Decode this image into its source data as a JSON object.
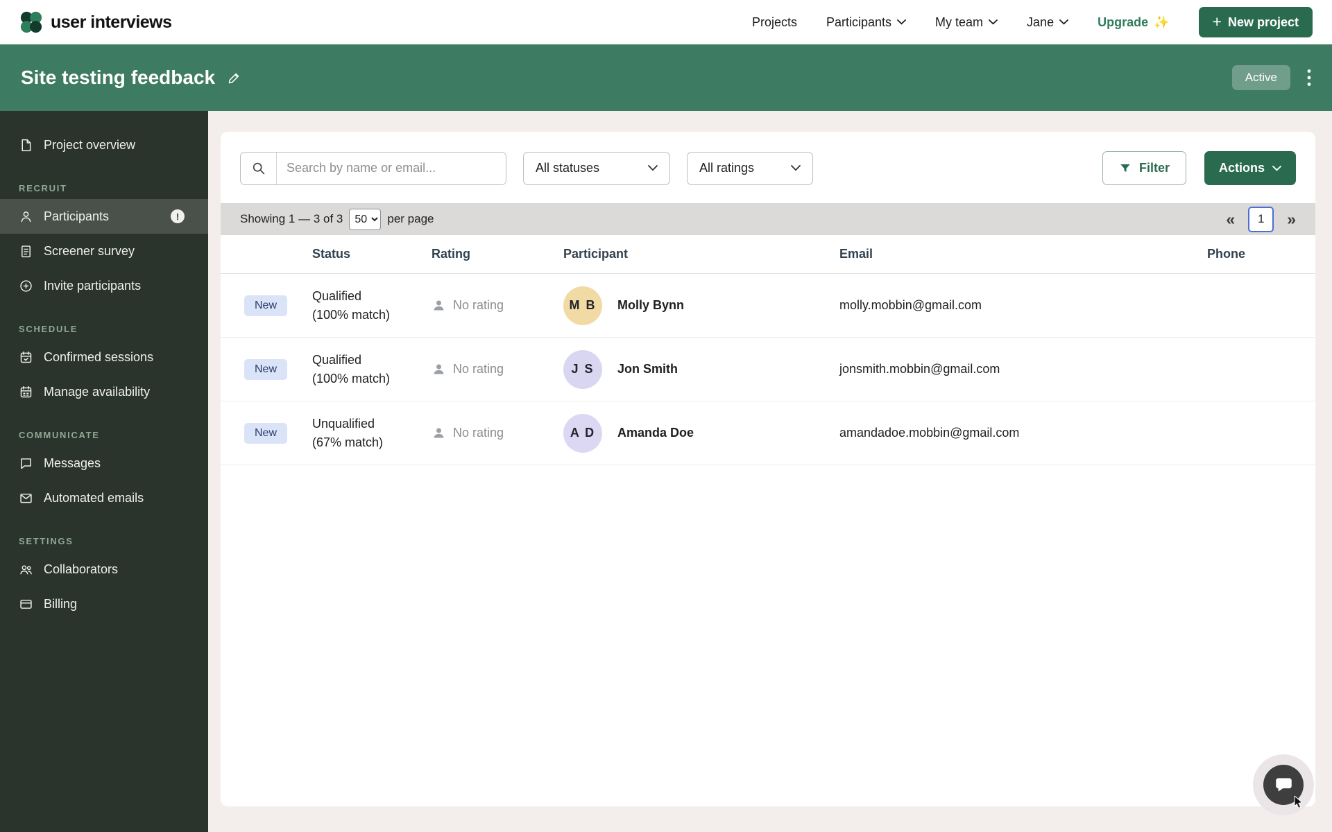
{
  "colors": {
    "accent_green": "#2a6b50",
    "header_green": "#3d7b62",
    "sidebar_bg": "#2a332c",
    "badge_new_bg": "#dbe3f8",
    "badge_new_text": "#2c3e6b",
    "pagebar_gray": "#dbdad8"
  },
  "topnav": {
    "brand": "user interviews",
    "projects": "Projects",
    "participants": "Participants",
    "my_team": "My team",
    "user": "Jane",
    "upgrade": "Upgrade",
    "upgrade_sparkle": "✨",
    "new_project_plus": "+",
    "new_project": "New project"
  },
  "project_header": {
    "title": "Site testing feedback",
    "status": "Active"
  },
  "sidebar": {
    "overview": "Project overview",
    "recruit_title": "RECRUIT",
    "participants": "Participants",
    "participants_alert": "!",
    "screener": "Screener survey",
    "invite": "Invite participants",
    "schedule_title": "SCHEDULE",
    "confirmed": "Confirmed sessions",
    "availability": "Manage availability",
    "communicate_title": "COMMUNICATE",
    "messages": "Messages",
    "emails": "Automated emails",
    "settings_title": "SETTINGS",
    "collaborators": "Collaborators",
    "billing": "Billing"
  },
  "toolbar": {
    "search_placeholder": "Search by name or email...",
    "status_filter": "All statuses",
    "rating_filter": "All ratings",
    "filter": "Filter",
    "actions": "Actions"
  },
  "pagination": {
    "showing": "Showing 1 — 3 of 3",
    "per_page_value": "50",
    "per_page_label": "per page",
    "prev": "«",
    "page": "1",
    "next": "»"
  },
  "table": {
    "headers": {
      "status": "Status",
      "rating": "Rating",
      "participant": "Participant",
      "email": "Email",
      "phone": "Phone"
    },
    "rows": [
      {
        "badge": "New",
        "status": "Qualified",
        "match": "(100% match)",
        "rating": "No rating",
        "initials": "M B",
        "name": "Molly Bynn",
        "email": "molly.mobbin@gmail.com",
        "phone": "",
        "avatar_bg": "#f2daa4"
      },
      {
        "badge": "New",
        "status": "Qualified",
        "match": "(100% match)",
        "rating": "No rating",
        "initials": "J S",
        "name": "Jon Smith",
        "email": "jonsmith.mobbin@gmail.com",
        "phone": "",
        "avatar_bg": "#d9d6f2"
      },
      {
        "badge": "New",
        "status": "Unqualified",
        "match": "(67% match)",
        "rating": "No rating",
        "initials": "A D",
        "name": "Amanda Doe",
        "email": "amandadoe.mobbin@gmail.com",
        "phone": "",
        "avatar_bg": "#dcd8f3"
      }
    ]
  }
}
